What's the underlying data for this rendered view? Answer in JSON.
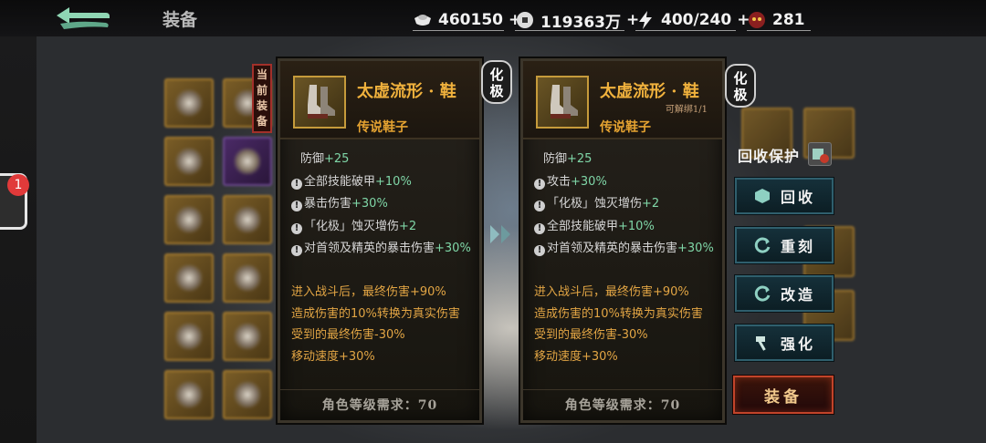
{
  "header": {
    "title": "装备",
    "resources": [
      {
        "icon": "silver-ingot-icon",
        "value": "460150"
      },
      {
        "icon": "coin-icon",
        "value": "119363万"
      },
      {
        "icon": "energy-bolt-icon",
        "value": "400/240"
      },
      {
        "icon": "demon-mask-icon",
        "value": "281"
      }
    ]
  },
  "notification": {
    "count": "1"
  },
  "current_tag": "当前装备",
  "left_item": {
    "name": "太虚流形 · 鞋",
    "type": "传说鞋子",
    "grade": "化极",
    "stats": [
      {
        "label": "防御",
        "value": "+25",
        "bullet": false
      },
      {
        "label": "全部技能破甲",
        "value": "+10%",
        "bullet": true
      },
      {
        "label": "暴击伤害",
        "value": "+30%",
        "bullet": true
      },
      {
        "label": "「化极」蚀灭增伤",
        "value": "+2",
        "bullet": true
      },
      {
        "label": "对首领及精英的暴击伤害",
        "value": "+30%",
        "bullet": true
      }
    ],
    "set_bonuses": [
      "进入战斗后，最终伤害+90%",
      "造成伤害的10%转换为真实伤害",
      "受到的最终伤害-30%",
      "移动速度+30%"
    ],
    "requirement": "角色等级需求：70"
  },
  "right_item": {
    "name": "太虚流形 · 鞋",
    "type": "传说鞋子",
    "sub": "可解绑1/1",
    "grade": "化极",
    "stats": [
      {
        "label": "防御",
        "value": "+25",
        "bullet": false
      },
      {
        "label": "攻击",
        "value": "+30%",
        "bullet": true
      },
      {
        "label": "「化极」蚀灭增伤",
        "value": "+2",
        "bullet": true
      },
      {
        "label": "全部技能破甲",
        "value": "+10%",
        "bullet": true
      },
      {
        "label": "对首领及精英的暴击伤害",
        "value": "+30%",
        "bullet": true
      }
    ],
    "set_bonuses": [
      "进入战斗后，最终伤害+90%",
      "造成伤害的10%转换为真实伤害",
      "受到的最终伤害-30%",
      "移动速度+30%"
    ],
    "requirement": "角色等级需求：70"
  },
  "actions": {
    "recycle_protect": "回收保护",
    "recycle": "回收",
    "reforge": "重刻",
    "modify": "改造",
    "enhance": "强化",
    "equip": "装备"
  },
  "colors": {
    "gold": "#f1b23d",
    "green": "#7fd6a7",
    "orange": "#e2a544",
    "teal": "#2f5f6d",
    "red": "#c2442a"
  }
}
